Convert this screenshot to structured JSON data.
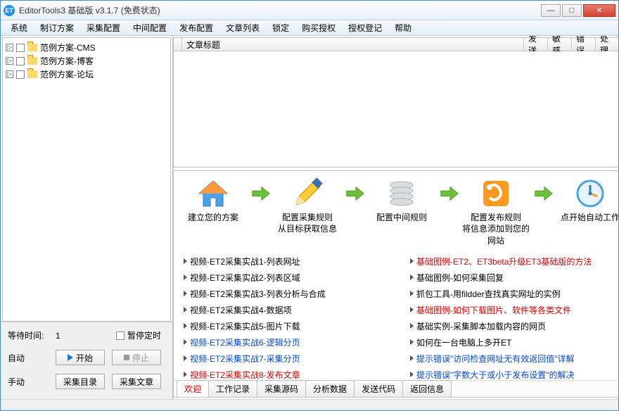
{
  "window": {
    "title": "EditorTools3 基础版 v3.1.7 (免费状态)"
  },
  "menu": [
    "系统",
    "制订方案",
    "采集配置",
    "中间配置",
    "发布配置",
    "文章列表",
    "锁定",
    "购买授权",
    "授权登记",
    "帮助"
  ],
  "tree": [
    {
      "label": "范例方案-CMS"
    },
    {
      "label": "范例方案-博客"
    },
    {
      "label": "范例方案-论坛"
    }
  ],
  "ctrl": {
    "wait_label": "等待时间:",
    "wait_value": "1",
    "pause_label": "暂停定时",
    "auto_label": "自动",
    "start_label": "开始",
    "stop_label": "停止",
    "manual_label": "手动",
    "collect_dir_label": "采集目录",
    "collect_article_label": "采集文章"
  },
  "grid": {
    "cols": {
      "title": "文章标题",
      "send": "发送",
      "sensitive": "敏感",
      "error": "错误",
      "process": "处理"
    }
  },
  "steps": [
    {
      "caption": "建立您的方案"
    },
    {
      "caption": "配置采集规则\n从目标获取信息"
    },
    {
      "caption": "配置中间规则"
    },
    {
      "caption": "配置发布规则\n将信息添加到您的网站"
    },
    {
      "caption": "点开始自动工作"
    }
  ],
  "links_left": [
    {
      "text": "视频-ET2采集实战1-列表网址",
      "color": "black"
    },
    {
      "text": "视频-ET2采集实战2-列表区域",
      "color": "black"
    },
    {
      "text": "视频-ET2采集实战3-列表分析与合成",
      "color": "black"
    },
    {
      "text": "视频-ET2采集实战4-数据项",
      "color": "black"
    },
    {
      "text": "视频-ET2采集实战5-图片下载",
      "color": "black"
    },
    {
      "text": "视频-ET2采集实战6-逻辑分页",
      "color": "blue"
    },
    {
      "text": "视频-ET2采集实战7-采集分页",
      "color": "blue"
    },
    {
      "text": "视频-ET2采集实战8-发布文章",
      "color": "red"
    }
  ],
  "links_right": [
    {
      "text": "基础图例-ET2、ET3beta升级ET3基础版的方法",
      "color": "red"
    },
    {
      "text": "基础图例-如何采集回复",
      "color": "black"
    },
    {
      "text": "抓包工具-用fildder查找真实网址的实例",
      "color": "black"
    },
    {
      "text": "基础图例-如何下载图片、软件等各类文件",
      "color": "red"
    },
    {
      "text": "基础实例-采集脚本加载内容的网页",
      "color": "black"
    },
    {
      "text": "如何在一台电脑上多开ET",
      "color": "black"
    },
    {
      "text": "提示错误\"访问检查网址无有效返回值\"详解",
      "color": "blue"
    },
    {
      "text": "提示错误\"字数大于或小于发布设置\"的解决",
      "color": "blue"
    }
  ],
  "tabs": [
    "欢迎",
    "工作记录",
    "采集源码",
    "分析数据",
    "发送代码",
    "返回信息"
  ],
  "active_tab": 0
}
